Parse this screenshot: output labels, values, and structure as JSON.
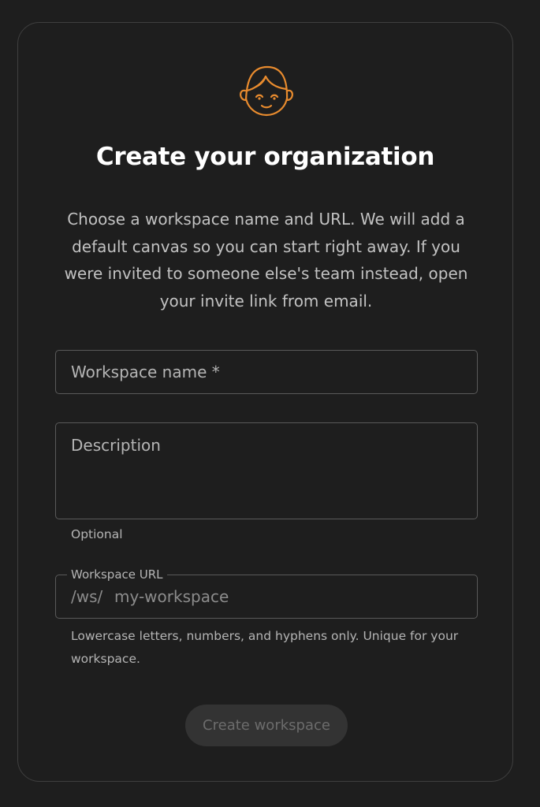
{
  "brand": {
    "logo_icon": "smiling-face-icon",
    "accent_color": "#e88b2e"
  },
  "page": {
    "title": "Create your organization",
    "intro": "Choose a workspace name and URL. We will add a default canvas so you can start right away. If you were invited to someone else's team instead, open your invite link from email."
  },
  "form": {
    "workspace_name": {
      "placeholder": "Workspace name *",
      "value": ""
    },
    "description": {
      "placeholder": "Description",
      "value": "",
      "helper": "Optional"
    },
    "workspace_url": {
      "label": "Workspace URL",
      "prefix": "/ws/",
      "placeholder": "my-workspace",
      "value": "",
      "helper": "Lowercase letters, numbers, and hyphens only. Unique for your workspace."
    },
    "submit_label": "Create workspace",
    "submit_disabled": true
  }
}
